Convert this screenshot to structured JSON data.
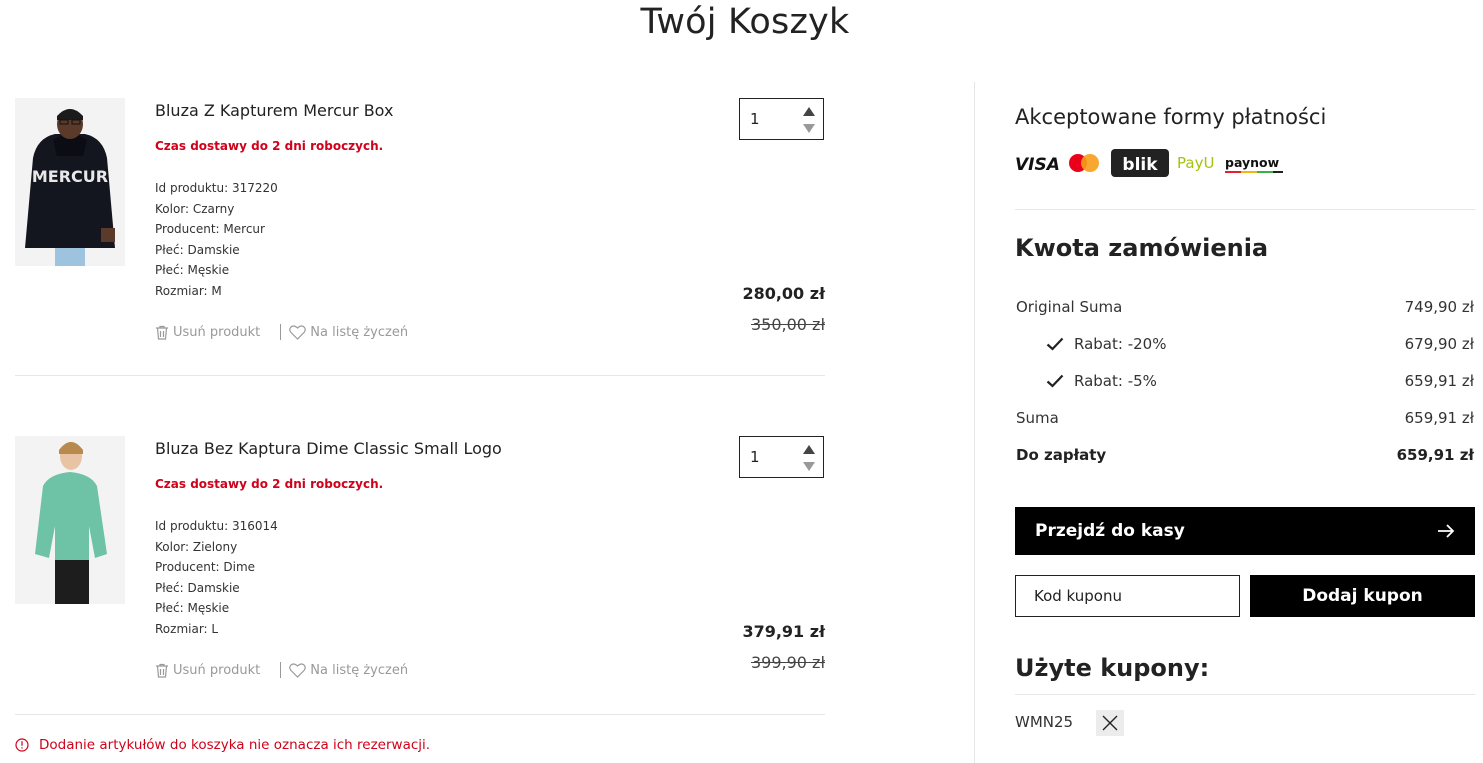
{
  "page": {
    "title": "Twój Koszyk"
  },
  "cart": {
    "items": [
      {
        "name": "Bluza Z Kapturem Mercur Box",
        "delivery": "Czas dostawy do 2 dni roboczych.",
        "attributes": [
          "Id produktu: 317220",
          "Kolor: Czarny",
          "Producent: Mercur",
          "Płeć: Damskie",
          "Płeć: Męskie",
          "Rozmiar: M"
        ],
        "quantity": "1",
        "price": "280,00 zł",
        "old_price": "350,00 zł",
        "remove_label": "Usuń produkt",
        "wishlist_label": "Na listę życzeń",
        "image_alt": "Mercur hoodie black",
        "print_text": "MERCUR"
      },
      {
        "name": "Bluza Bez Kaptura Dime Classic Small Logo",
        "delivery": "Czas dostawy do 2 dni roboczych.",
        "attributes": [
          "Id produktu: 316014",
          "Kolor: Zielony",
          "Producent: Dime",
          "Płeć: Damskie",
          "Płeć: Męskie",
          "Rozmiar: L"
        ],
        "quantity": "1",
        "price": "379,91 zł",
        "old_price": "399,90 zł",
        "remove_label": "Usuń produkt",
        "wishlist_label": "Na listę życzeń",
        "image_alt": "Dime crewneck green"
      }
    ],
    "notice": "Dodanie artykułów do koszyka nie oznacza ich rezerwacji."
  },
  "payments": {
    "title": "Akceptowane formy płatności",
    "methods": [
      "VISA",
      "Mastercard",
      "blik",
      "PayU",
      "paynow"
    ],
    "logo_text": {
      "visa": "VISA",
      "blik": "blik",
      "payu": "PayU",
      "paynow": "paynow"
    }
  },
  "summary": {
    "title": "Kwota zamówienia",
    "rows": [
      {
        "label": "Original Suma",
        "value": "749,90 zł"
      },
      {
        "label": "Rabat: -20%",
        "value": "679,90 zł"
      },
      {
        "label": "Rabat: -5%",
        "value": "659,91 zł"
      },
      {
        "label": "Suma",
        "value": "659,91 zł"
      },
      {
        "label": "Do zapłaty",
        "value": "659,91 zł"
      }
    ],
    "checkout_label": "Przejdź do kasy"
  },
  "coupon": {
    "placeholder": "Kod kuponu",
    "add_label": "Dodaj kupon",
    "used_title": "Użyte kupony:",
    "used_codes": [
      "WMN25"
    ]
  },
  "colors": {
    "accent": "#000000",
    "error": "#d0021b",
    "divider": "#e6e6e6"
  }
}
